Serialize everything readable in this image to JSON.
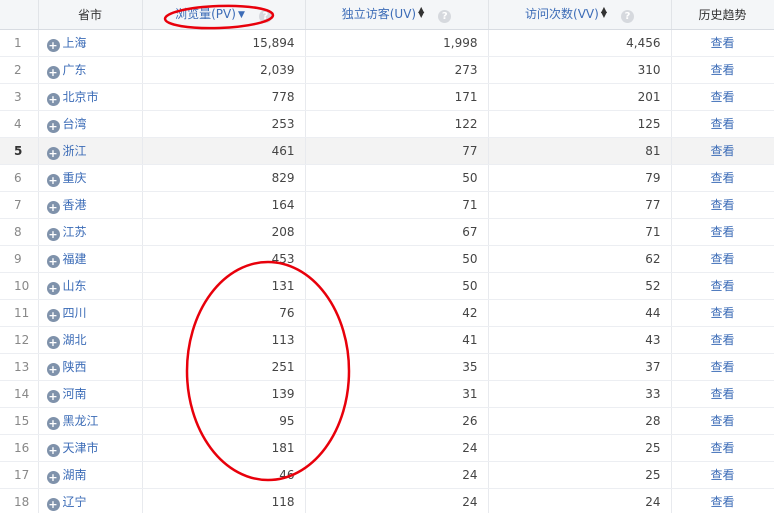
{
  "header": {
    "province": "省市",
    "pv": "浏览量(PV)",
    "uv": "独立访客(UV)",
    "vv": "访问次数(VV)",
    "trend": "历史趋势"
  },
  "icons": {
    "expand": "plus-circle-icon",
    "help": "question-circle-icon",
    "sort_desc": "sort-down-icon",
    "sort_both": "sort-updown-icon"
  },
  "colors": {
    "link": "#3c6cb7",
    "annotation": "#e8000b",
    "highlight_row": "#f3f3f3"
  },
  "rows": [
    {
      "idx": "1",
      "province": "上海",
      "pv": "15,894",
      "uv": "1,998",
      "vv": "4,456",
      "trend": "查看"
    },
    {
      "idx": "2",
      "province": "广东",
      "pv": "2,039",
      "uv": "273",
      "vv": "310",
      "trend": "查看"
    },
    {
      "idx": "3",
      "province": "北京市",
      "pv": "778",
      "uv": "171",
      "vv": "201",
      "trend": "查看"
    },
    {
      "idx": "4",
      "province": "台湾",
      "pv": "253",
      "uv": "122",
      "vv": "125",
      "trend": "查看"
    },
    {
      "idx": "5",
      "province": "浙江",
      "pv": "461",
      "uv": "77",
      "vv": "81",
      "trend": "查看"
    },
    {
      "idx": "6",
      "province": "重庆",
      "pv": "829",
      "uv": "50",
      "vv": "79",
      "trend": "查看"
    },
    {
      "idx": "7",
      "province": "香港",
      "pv": "164",
      "uv": "71",
      "vv": "77",
      "trend": "查看"
    },
    {
      "idx": "8",
      "province": "江苏",
      "pv": "208",
      "uv": "67",
      "vv": "71",
      "trend": "查看"
    },
    {
      "idx": "9",
      "province": "福建",
      "pv": "453",
      "uv": "50",
      "vv": "62",
      "trend": "查看"
    },
    {
      "idx": "10",
      "province": "山东",
      "pv": "131",
      "uv": "50",
      "vv": "52",
      "trend": "查看"
    },
    {
      "idx": "11",
      "province": "四川",
      "pv": "76",
      "uv": "42",
      "vv": "44",
      "trend": "查看"
    },
    {
      "idx": "12",
      "province": "湖北",
      "pv": "113",
      "uv": "41",
      "vv": "43",
      "trend": "查看"
    },
    {
      "idx": "13",
      "province": "陕西",
      "pv": "251",
      "uv": "35",
      "vv": "37",
      "trend": "查看"
    },
    {
      "idx": "14",
      "province": "河南",
      "pv": "139",
      "uv": "31",
      "vv": "33",
      "trend": "查看"
    },
    {
      "idx": "15",
      "province": "黑龙江",
      "pv": "95",
      "uv": "26",
      "vv": "28",
      "trend": "查看"
    },
    {
      "idx": "16",
      "province": "天津市",
      "pv": "181",
      "uv": "24",
      "vv": "25",
      "trend": "查看"
    },
    {
      "idx": "17",
      "province": "湖南",
      "pv": "46",
      "uv": "24",
      "vv": "25",
      "trend": "查看"
    },
    {
      "idx": "18",
      "province": "辽宁",
      "pv": "118",
      "uv": "24",
      "vv": "24",
      "trend": "查看"
    }
  ]
}
